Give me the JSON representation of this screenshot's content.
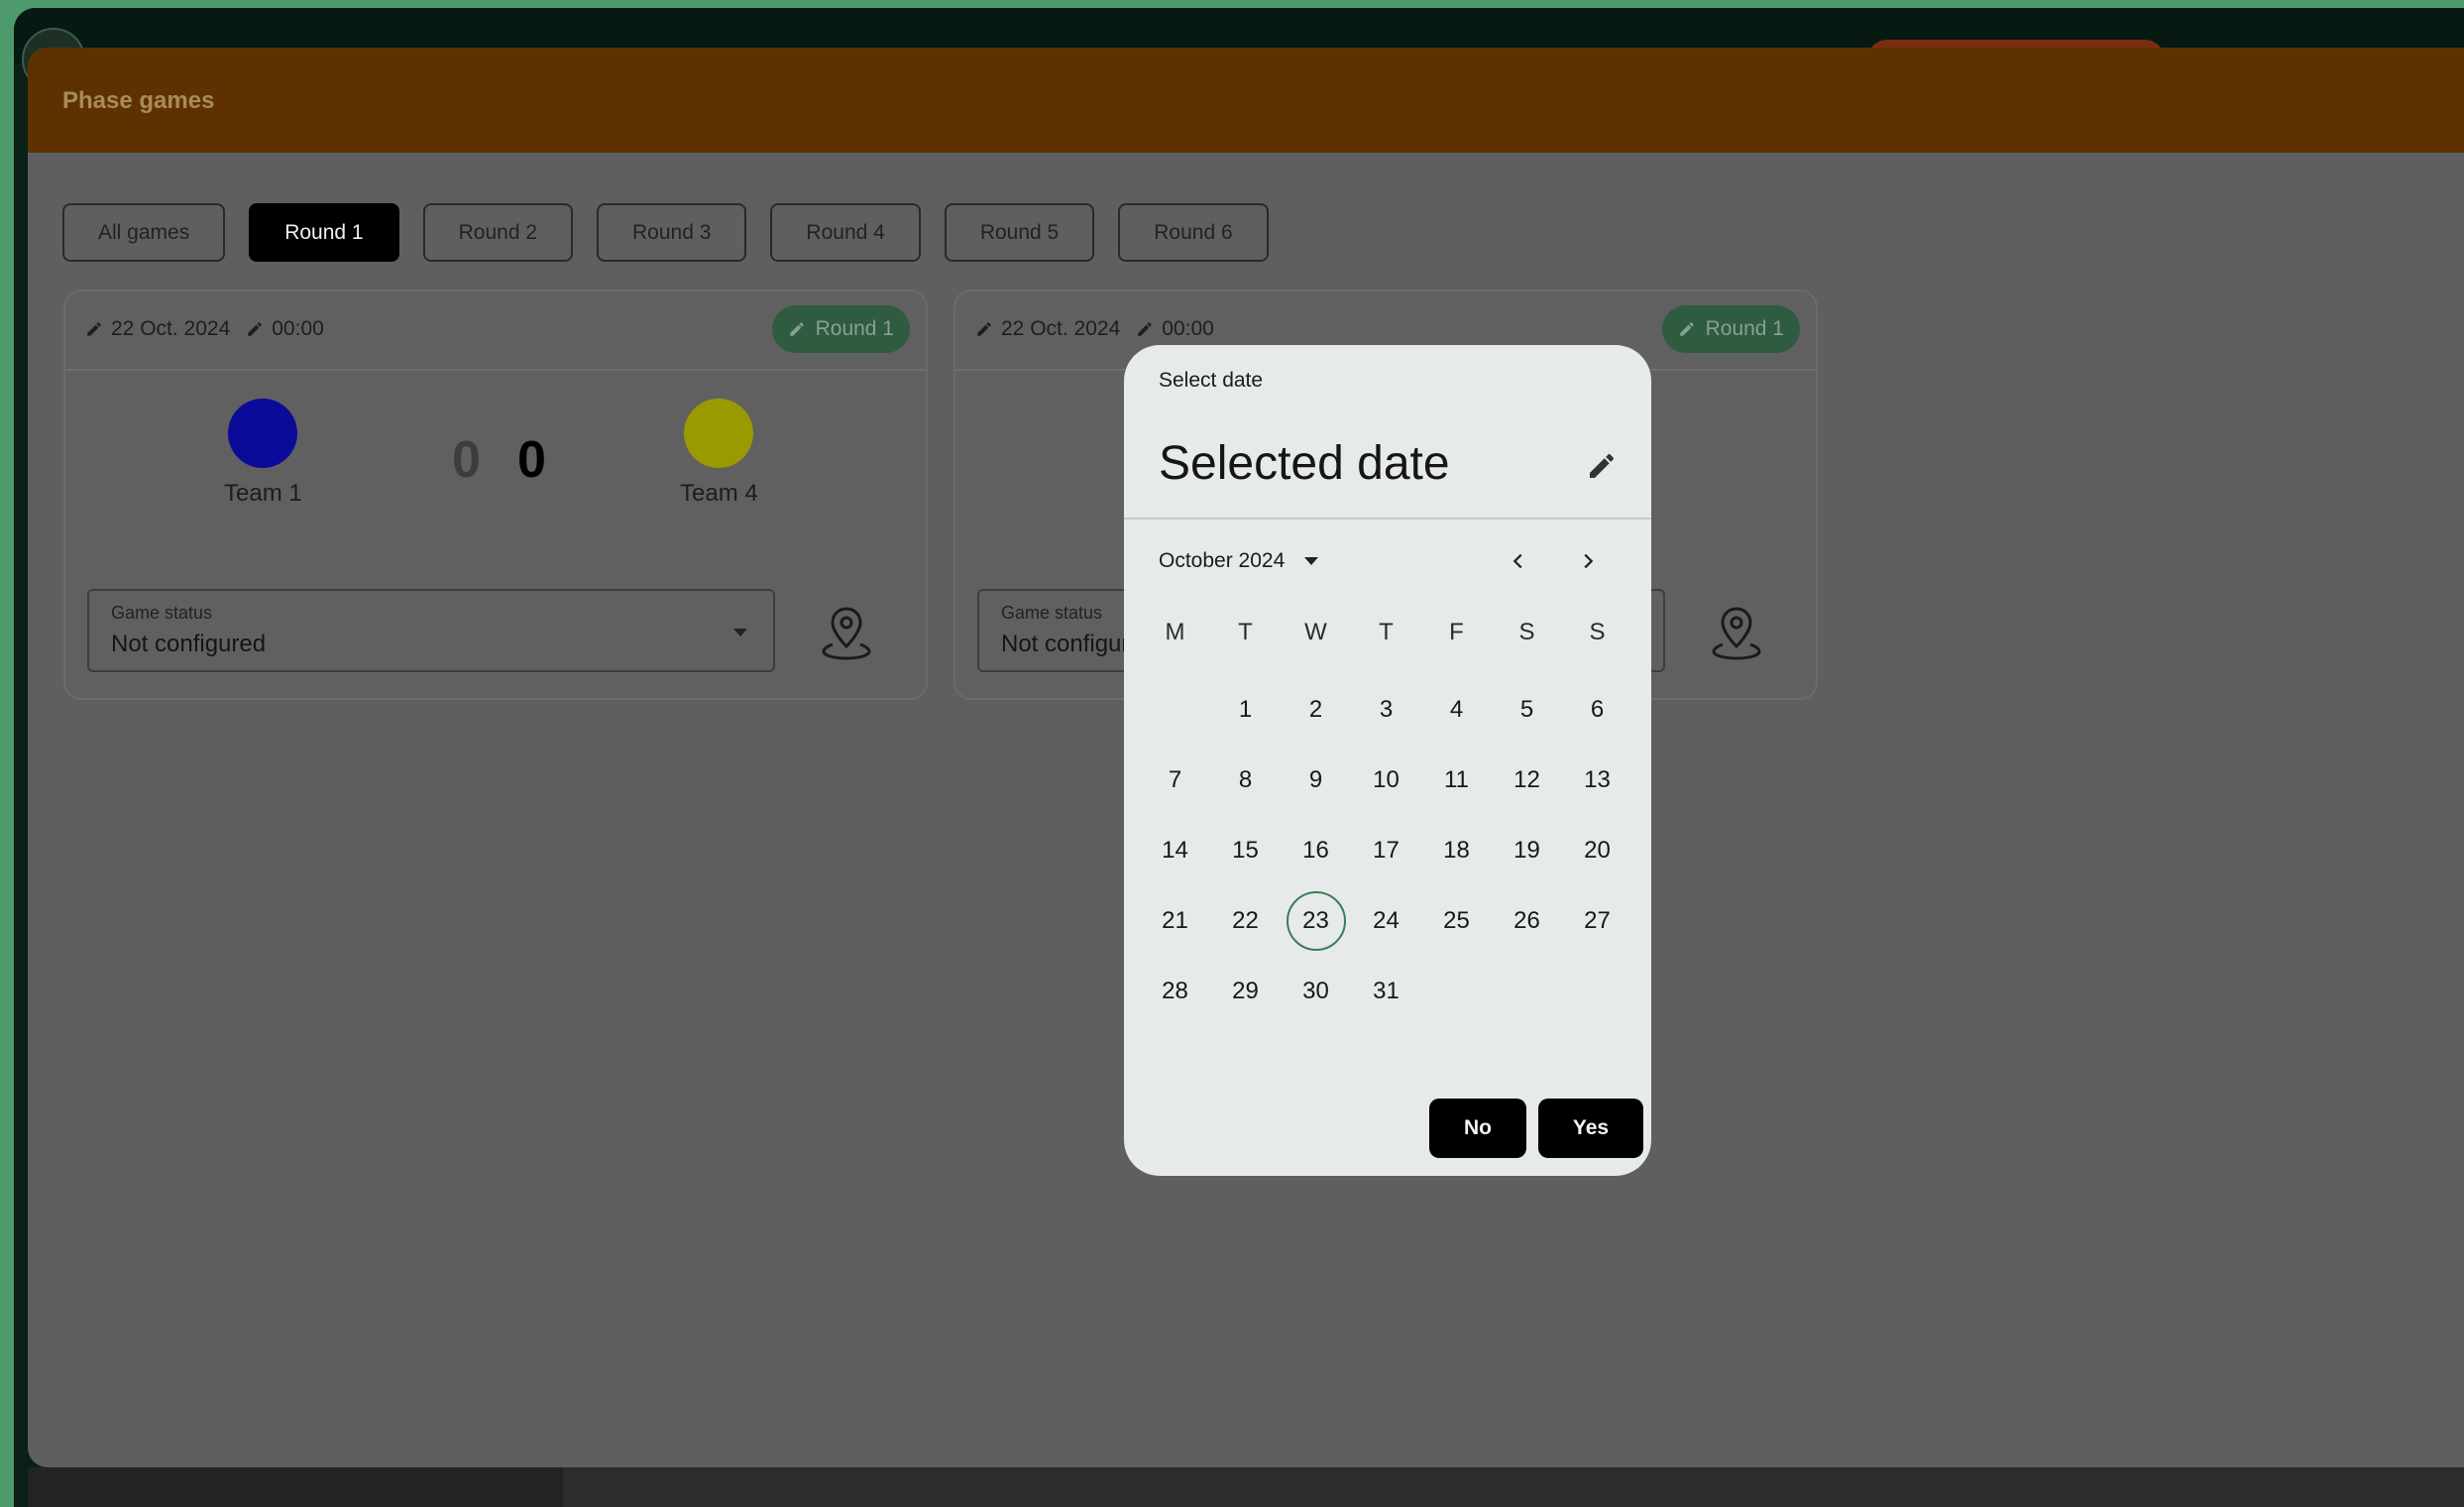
{
  "phase": {
    "title": "Phase games"
  },
  "tabs": [
    {
      "label": "All games",
      "active": false
    },
    {
      "label": "Round 1",
      "active": true
    },
    {
      "label": "Round 2",
      "active": false
    },
    {
      "label": "Round 3",
      "active": false
    },
    {
      "label": "Round 4",
      "active": false
    },
    {
      "label": "Round 5",
      "active": false
    },
    {
      "label": "Round 6",
      "active": false
    }
  ],
  "games": [
    {
      "date": "22 Oct. 2024",
      "time": "00:00",
      "round": "Round 1",
      "home": {
        "name": "Team 1",
        "color": "#0b0b99"
      },
      "away": {
        "name": "Team 4",
        "color": "#9a9a00"
      },
      "home_score": "0",
      "away_score": "0",
      "status_label": "Game status",
      "status_value": "Not configured"
    },
    {
      "date": "22 Oct. 2024",
      "time": "00:00",
      "round": "Round 1",
      "status_label": "Game status",
      "status_value": "Not configured"
    }
  ],
  "dialog": {
    "subtitle": "Select date",
    "title": "Selected date",
    "month": "October 2024",
    "weekdays": [
      "M",
      "T",
      "W",
      "T",
      "F",
      "S",
      "S"
    ],
    "days": [
      "",
      "1",
      "2",
      "3",
      "4",
      "5",
      "6",
      "7",
      "8",
      "9",
      "10",
      "11",
      "12",
      "13",
      "14",
      "15",
      "16",
      "17",
      "18",
      "19",
      "20",
      "21",
      "22",
      "23",
      "24",
      "25",
      "26",
      "27",
      "28",
      "29",
      "30",
      "31"
    ],
    "today": "23",
    "cancel": "No",
    "confirm": "Yes"
  },
  "colors": {
    "active_tab": "#000000",
    "round_badge": "#2f5b40",
    "header": "#5e3200",
    "today_ring": "#3b7d58"
  }
}
